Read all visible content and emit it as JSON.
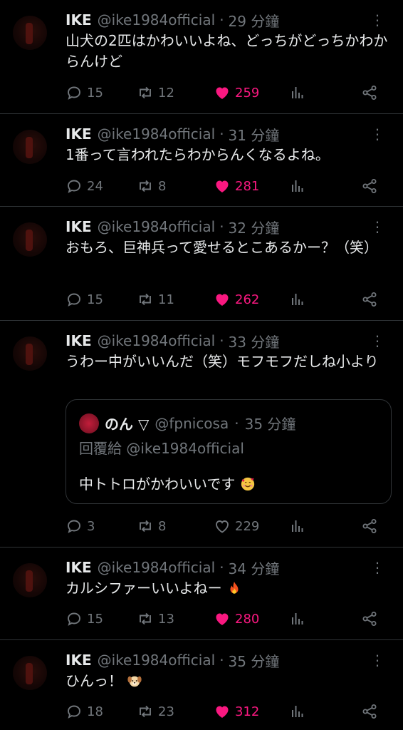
{
  "tweets": [
    {
      "name": "IKE",
      "handle": "@ike1984official",
      "time": "29 分鐘",
      "text": "山犬の2匹はかわいいよね、どっちがどっちかわからんけど",
      "replies": "15",
      "retweets": "12",
      "likes": "259",
      "liked": true
    },
    {
      "name": "IKE",
      "handle": "@ike1984official",
      "time": "31 分鐘",
      "text": "1番って言われたらわからんくなるよね。",
      "replies": "24",
      "retweets": "8",
      "likes": "281",
      "liked": true
    },
    {
      "name": "IKE",
      "handle": "@ike1984official",
      "time": "32 分鐘",
      "text": "おもろ、巨神兵って愛せるとこあるかー？（笑）",
      "replies": "15",
      "retweets": "11",
      "likes": "262",
      "liked": true
    },
    {
      "name": "IKE",
      "handle": "@ike1984official",
      "time": "33 分鐘",
      "text": "うわー中がいいんだ（笑）モフモフだしね小より",
      "replies": "3",
      "retweets": "8",
      "likes": "229",
      "liked": false,
      "quote": {
        "name": "のん ▽",
        "handle": "@fpnicosa",
        "time": "35 分鐘",
        "reply_to": "回覆給 @ike1984official",
        "text": "中トトロがかわいいです",
        "emoji": "smiling-face-with-hearts"
      }
    },
    {
      "name": "IKE",
      "handle": "@ike1984official",
      "time": "34 分鐘",
      "text": "カルシファーいいよねー",
      "emoji": "fire",
      "replies": "15",
      "retweets": "13",
      "likes": "280",
      "liked": true
    },
    {
      "name": "IKE",
      "handle": "@ike1984official",
      "time": "35 分鐘",
      "text": "ひんっ！",
      "emoji": "dog-face",
      "replies": "18",
      "retweets": "23",
      "likes": "312",
      "liked": true
    }
  ],
  "separator": "·",
  "colors": {
    "like": "#f91880",
    "muted": "#71767b",
    "text": "#e7e9ea",
    "border": "#2f3336",
    "background": "#000000"
  }
}
